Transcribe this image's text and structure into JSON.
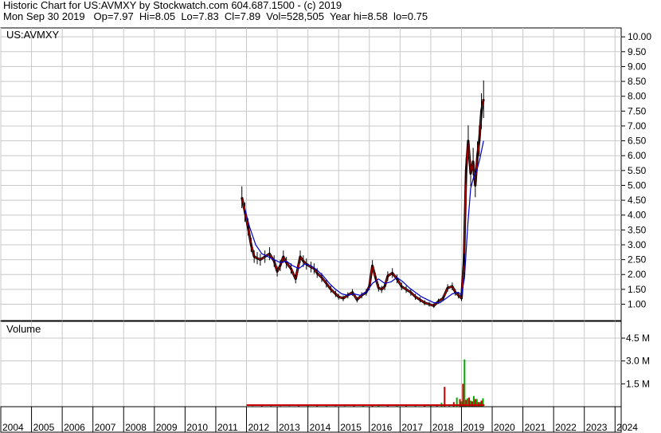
{
  "header": {
    "line1": "Historic Chart for US:AVMXY by Stockwatch.com 604.687.1500 - (c) 2019",
    "line2": "Mon Sep 30 2019   Op=7.97  Hi=8.05  Lo=7.83  Cl=7.89  Vol=528,505  Year hi=8.58  lo=0.75"
  },
  "colors": {
    "price_bar": "#000000",
    "price_close": "#cc0000",
    "moving_average": "#0000cc",
    "volume_up": "#00aa00",
    "volume_down": "#cc0000",
    "grid": "#c8c8c8"
  },
  "chart_data": [
    {
      "type": "line",
      "panel": "price",
      "label": "US:AVMXY",
      "y_ticks": [
        "1.00",
        "1.50",
        "2.00",
        "2.50",
        "3.00",
        "3.50",
        "4.00",
        "4.50",
        "5.00",
        "5.50",
        "6.00",
        "6.50",
        "7.00",
        "7.50",
        "8.00",
        "8.50",
        "9.00",
        "9.50",
        "10.00"
      ],
      "ylim": [
        0.45,
        10.3
      ],
      "xlim": [
        2004,
        2024.2
      ],
      "grid": true,
      "series": [
        {
          "style": "price",
          "x": [
            2011.85,
            2011.95,
            2012.05,
            2012.15,
            2012.25,
            2012.35,
            2012.45,
            2012.6,
            2012.75,
            2012.9,
            2013.0,
            2013.1,
            2013.2,
            2013.3,
            2013.45,
            2013.6,
            2013.75,
            2013.85,
            2013.95,
            2014.1,
            2014.2,
            2014.3,
            2014.45,
            2014.6,
            2014.75,
            2014.9,
            2015.0,
            2015.15,
            2015.3,
            2015.45,
            2015.6,
            2015.75,
            2015.9,
            2016.0,
            2016.1,
            2016.2,
            2016.3,
            2016.4,
            2016.5,
            2016.6,
            2016.75,
            2016.9,
            2017.05,
            2017.2,
            2017.35,
            2017.5,
            2017.65,
            2017.8,
            2017.95,
            2018.1,
            2018.25,
            2018.4,
            2018.55,
            2018.7,
            2018.8,
            2018.9,
            2019.0,
            2019.08,
            2019.15,
            2019.22,
            2019.3,
            2019.38,
            2019.45,
            2019.52,
            2019.58,
            2019.65,
            2019.72
          ],
          "values": [
            4.6,
            4.1,
            3.6,
            3.0,
            2.6,
            2.55,
            2.5,
            2.6,
            2.7,
            2.45,
            2.1,
            2.3,
            2.6,
            2.4,
            2.2,
            1.85,
            2.6,
            2.45,
            2.35,
            2.25,
            2.2,
            2.05,
            1.9,
            1.7,
            1.5,
            1.35,
            1.25,
            1.2,
            1.3,
            1.4,
            1.15,
            1.3,
            1.4,
            1.6,
            2.3,
            1.9,
            1.55,
            1.5,
            1.6,
            1.95,
            2.05,
            1.85,
            1.6,
            1.5,
            1.4,
            1.25,
            1.15,
            1.05,
            1.0,
            0.95,
            1.1,
            1.2,
            1.55,
            1.6,
            1.4,
            1.3,
            1.2,
            2.5,
            5.5,
            6.5,
            5.4,
            5.8,
            5.0,
            6.0,
            6.5,
            7.5,
            7.9
          ]
        },
        {
          "style": "moving_average",
          "x": [
            2011.95,
            2012.1,
            2012.3,
            2012.5,
            2012.7,
            2012.9,
            2013.1,
            2013.3,
            2013.5,
            2013.7,
            2013.9,
            2014.1,
            2014.3,
            2014.5,
            2014.7,
            2014.9,
            2015.1,
            2015.3,
            2015.5,
            2015.7,
            2015.9,
            2016.1,
            2016.3,
            2016.5,
            2016.7,
            2016.9,
            2017.1,
            2017.3,
            2017.5,
            2017.7,
            2017.9,
            2018.1,
            2018.3,
            2018.5,
            2018.7,
            2018.9,
            2019.0,
            2019.1,
            2019.2,
            2019.3,
            2019.4,
            2019.5,
            2019.6,
            2019.72
          ],
          "values": [
            4.2,
            3.6,
            3.0,
            2.7,
            2.6,
            2.5,
            2.4,
            2.45,
            2.3,
            2.2,
            2.35,
            2.3,
            2.15,
            1.95,
            1.7,
            1.5,
            1.35,
            1.3,
            1.35,
            1.3,
            1.4,
            1.7,
            1.85,
            1.7,
            1.75,
            1.9,
            1.75,
            1.55,
            1.4,
            1.25,
            1.15,
            1.05,
            1.05,
            1.2,
            1.35,
            1.4,
            1.3,
            1.9,
            3.6,
            4.9,
            5.3,
            5.5,
            5.9,
            6.5
          ]
        }
      ]
    },
    {
      "type": "bar",
      "panel": "volume",
      "label": "Volume",
      "y_ticks": [
        "1.5 M",
        "3.0 M",
        "4.5 M"
      ],
      "ylim": [
        0,
        5.6
      ],
      "x_ticks": [
        "2004",
        "2005",
        "2006",
        "2007",
        "2008",
        "2009",
        "2010",
        "2011",
        "2012",
        "2013",
        "2014",
        "2015",
        "2016",
        "2017",
        "2018",
        "2019",
        "2020",
        "2021",
        "2022",
        "2023",
        "2024"
      ],
      "xlim": [
        2004,
        2024.2
      ],
      "series": [
        {
          "name": "up",
          "x": [
            2012.2,
            2012.8,
            2013.4,
            2014.0,
            2014.6,
            2015.2,
            2015.8,
            2016.3,
            2016.9,
            2017.5,
            2018.0,
            2018.35,
            2018.6,
            2018.85,
            2019.0,
            2019.1,
            2019.2,
            2019.3,
            2019.4,
            2019.5,
            2019.6,
            2019.7
          ],
          "values": [
            0.04,
            0.05,
            0.04,
            0.06,
            0.05,
            0.04,
            0.06,
            0.08,
            0.05,
            0.06,
            0.12,
            0.25,
            0.15,
            0.6,
            0.35,
            3.1,
            0.55,
            0.4,
            0.7,
            0.5,
            0.3,
            0.55
          ]
        },
        {
          "name": "down",
          "x": [
            2012.5,
            2013.1,
            2013.7,
            2014.3,
            2014.9,
            2015.5,
            2016.1,
            2016.6,
            2017.2,
            2017.8,
            2018.2,
            2018.45,
            2018.75,
            2018.95,
            2019.05,
            2019.15,
            2019.25,
            2019.35,
            2019.45,
            2019.55,
            2019.65
          ],
          "values": [
            0.05,
            0.04,
            0.05,
            0.05,
            0.04,
            0.05,
            0.07,
            0.06,
            0.05,
            0.07,
            0.1,
            1.3,
            0.3,
            0.5,
            1.5,
            0.45,
            0.6,
            0.35,
            0.5,
            0.3,
            0.4
          ]
        }
      ]
    }
  ]
}
